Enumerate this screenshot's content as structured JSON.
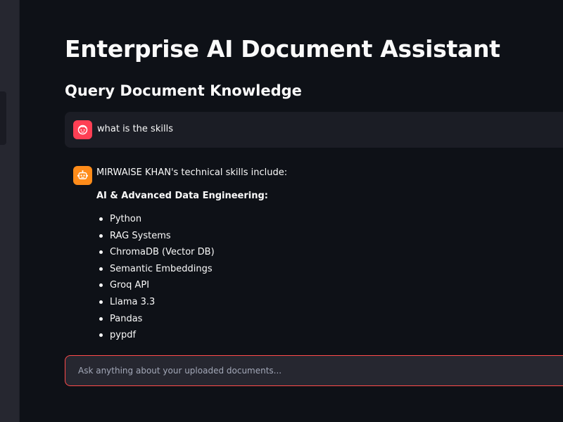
{
  "page": {
    "title": "Enterprise AI Document Assistant",
    "section_title": "Query Document Knowledge"
  },
  "chat": {
    "messages": [
      {
        "role": "user",
        "avatar_icon": "user-face-icon",
        "text": "what is the skills"
      },
      {
        "role": "assistant",
        "avatar_icon": "robot-icon",
        "intro": "MIRWAISE KHAN's technical skills include:",
        "subheading": "AI & Advanced Data Engineering:",
        "items": [
          "Python",
          "RAG Systems",
          "ChromaDB (Vector DB)",
          "Semantic Embeddings",
          "Groq API",
          "Llama 3.3",
          "Pandas",
          "pypdf"
        ]
      }
    ],
    "input": {
      "placeholder": "Ask anything about your uploaded documents...",
      "value": ""
    }
  },
  "colors": {
    "background": "#0e1117",
    "sidebar": "#262730",
    "user_avatar": "#ff3f54",
    "assistant_avatar": "#ff8c1a",
    "input_border": "#ff4b4b"
  }
}
